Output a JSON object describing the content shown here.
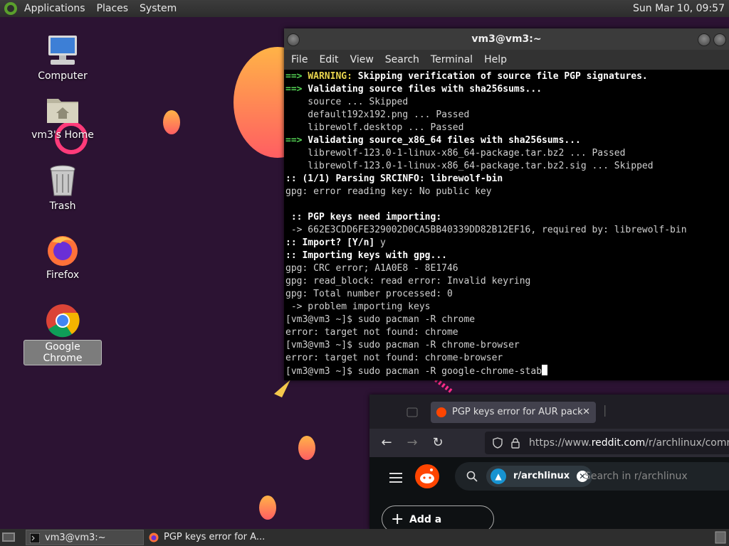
{
  "top_panel": {
    "menus": [
      "Applications",
      "Places",
      "System"
    ],
    "clock": "Sun Mar 10, 09:57"
  },
  "desktop": {
    "icons": [
      {
        "label": "Computer",
        "icon": "computer-icon"
      },
      {
        "label": "vm3's Home",
        "icon": "home-folder-icon"
      },
      {
        "label": "Trash",
        "icon": "trash-icon"
      },
      {
        "label": "Firefox",
        "icon": "firefox-icon"
      },
      {
        "label": "Google Chrome",
        "icon": "chrome-icon"
      }
    ]
  },
  "terminal": {
    "title": "vm3@vm3:~",
    "menu": [
      "File",
      "Edit",
      "View",
      "Search",
      "Terminal",
      "Help"
    ],
    "lines": [
      "==> WARNING: Skipping verification of source file PGP signatures.",
      "==> Validating source files with sha256sums...",
      "    source ... Skipped",
      "    default192x192.png ... Passed",
      "    librewolf.desktop ... Passed",
      "==> Validating source_x86_64 files with sha256sums...",
      "    librewolf-123.0-1-linux-x86_64-package.tar.bz2 ... Passed",
      "    librewolf-123.0-1-linux-x86_64-package.tar.bz2.sig ... Skipped",
      ":: (1/1) Parsing SRCINFO: librewolf-bin",
      "gpg: error reading key: No public key",
      "",
      " :: PGP keys need importing:",
      " -> 662E3CDD6FE329002D0CA5BB40339DD82B12EF16, required by: librewolf-bin",
      ":: Import? [Y/n] y",
      ":: Importing keys with gpg...",
      "gpg: CRC error; A1A0E8 - 8E1746",
      "gpg: read_block: read error: Invalid keyring",
      "gpg: Total number processed: 0",
      " -> problem importing keys",
      "[vm3@vm3 ~]$ sudo pacman -R chrome",
      "error: target not found: chrome",
      "[vm3@vm3 ~]$ sudo pacman -R chrome-browser",
      "error: target not found: chrome-browser",
      "[vm3@vm3 ~]$ sudo pacman -R google-chrome-stab"
    ]
  },
  "browser": {
    "tab_title": "PGP keys error for AUR pack",
    "url_prefix": "https://www.",
    "url_host": "reddit.com",
    "url_path": "/r/archlinux/commen",
    "subreddit_chip": "r/archlinux",
    "search_placeholder": "Search in r/archlinux",
    "add_comment": "Add a Comment"
  },
  "taskbar": {
    "tasks": [
      "vm3@vm3:~",
      "PGP keys error for A..."
    ]
  },
  "colors": {
    "wallpaper": "#2c1333",
    "terminal_bg": "#000000",
    "prompt_green": "#55d555",
    "warning_yellow": "#e8d44d",
    "reddit_orange": "#ff4500"
  }
}
